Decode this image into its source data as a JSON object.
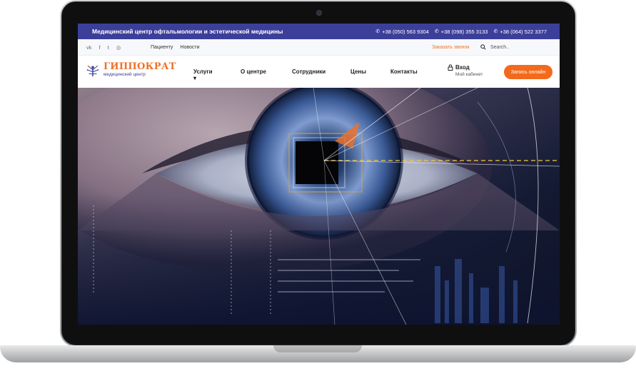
{
  "topbar": {
    "title": "Медицинский центр офтальмологии и эстетической медицины",
    "phones": [
      "+38 (050) 563 9304",
      "+38 (098) 355 3133",
      "+38 (064) 522 3377"
    ]
  },
  "subbar": {
    "social": [
      "vk",
      "f",
      "t",
      "ig"
    ],
    "links": [
      "Пациенту",
      "Новости"
    ],
    "callback": "Заказать звонок",
    "search_placeholder": "Search.."
  },
  "logo": {
    "name": "ГИППОКРАТ",
    "subtitle": "медицинский центр"
  },
  "menu": {
    "services": "Услуги",
    "about": "О центре",
    "staff": "Сотрудники",
    "prices": "Цены",
    "contacts": "Контакты"
  },
  "login": {
    "label": "Вход",
    "cabinet": "Мой кабинет"
  },
  "book_button": "Запись онлайн",
  "colors": {
    "brand_blue": "#3c3f99",
    "accent_orange": "#f26a1b"
  }
}
